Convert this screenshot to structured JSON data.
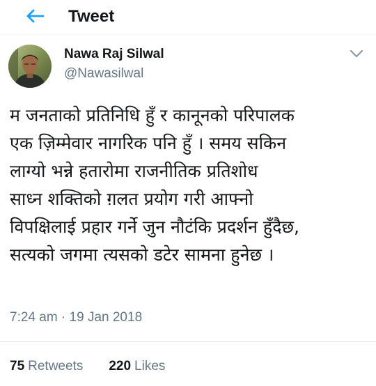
{
  "header": {
    "title": "Tweet",
    "back_icon": "arrow-left-icon",
    "accent_color": "#1da1f2"
  },
  "tweet": {
    "author": {
      "name": "Nawa Raj Silwal",
      "handle": "@Nawasilwal"
    },
    "body_lines": [
      "म जनताको प्रतिनिधि हुँ र कानूनको परिपालक",
      "एक ज़िम्मेवार नागरिक पनि हुँ । समय सकिन",
      "लाग्यो भन्ने हतारोमा राजनीतिक प्रतिशोध",
      "साध्न शक्तिको ग़लत प्रयोग गरी आफ्नो",
      "विपक्षिलाई प्रहार गर्ने जुन नौटंकि प्रदर्शन हुँदैछ,",
      "सत्यको जगमा त्यसको डटेर सामना हुनेछ ।"
    ],
    "timestamp": "7:24 am · 19 Jan 2018",
    "stats": {
      "retweets_count": "75",
      "retweets_label": "Retweets",
      "likes_count": "220",
      "likes_label": "Likes"
    }
  }
}
